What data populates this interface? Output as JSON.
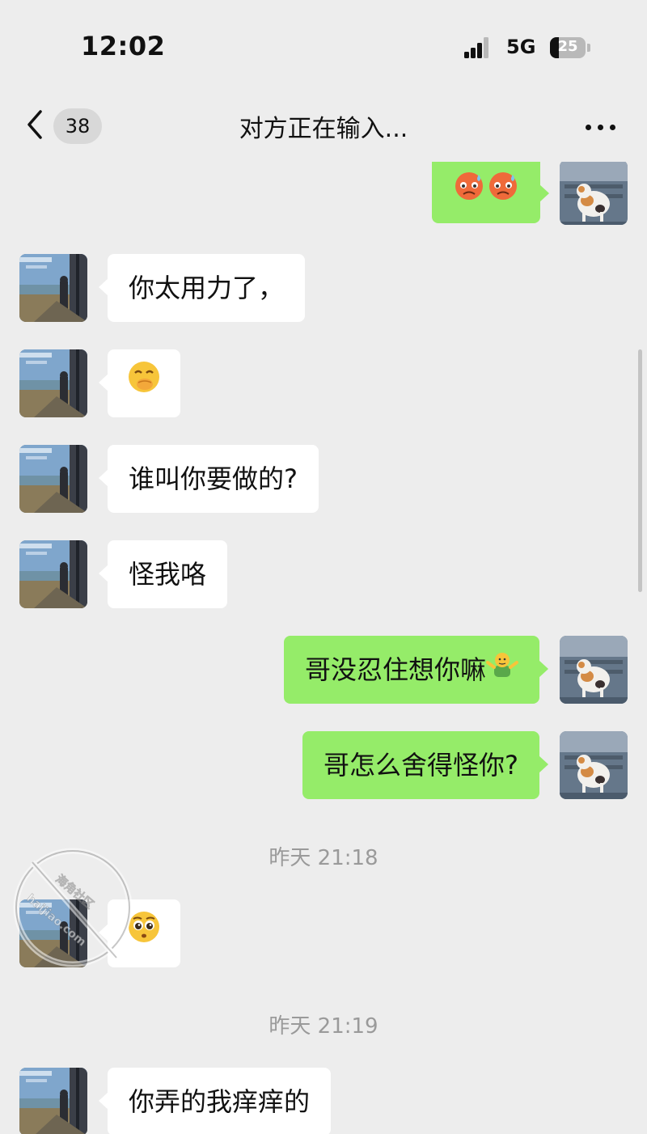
{
  "status_bar": {
    "time": "12:02",
    "network": "5G",
    "battery": "25",
    "battery_level": 0.25
  },
  "nav": {
    "back_icon": "chevron-left-icon",
    "unread_count": "38",
    "title": "对方正在输入...",
    "more_icon": "more-dots-icon"
  },
  "messages": [
    {
      "side": "out",
      "emoji": "anxious-sweat-face x2"
    },
    {
      "side": "in",
      "text": "你太用力了，"
    },
    {
      "side": "in",
      "emoji": "face-with-hand-over-mouth"
    },
    {
      "side": "in",
      "text": "谁叫你要做的?"
    },
    {
      "side": "in",
      "text": "怪我咯"
    },
    {
      "side": "out",
      "text": "哥没忍住想你嘛",
      "emoji": "shrugging-person"
    },
    {
      "side": "out",
      "text": "哥怎么舍得怪你?"
    },
    {
      "type": "timestamp",
      "text": "昨天 21:18"
    },
    {
      "side": "in",
      "emoji": "pleading-face"
    },
    {
      "type": "timestamp",
      "text": "昨天 21:19"
    },
    {
      "side": "in",
      "text": "你弄的我痒痒的"
    }
  ],
  "watermark": {
    "text": "海角社区",
    "domain": "haijiao.com"
  },
  "colors": {
    "background": "#ededed",
    "incoming_bubble": "#ffffff",
    "outgoing_bubble": "#95ec69",
    "timestamp": "#9a9a9a"
  }
}
